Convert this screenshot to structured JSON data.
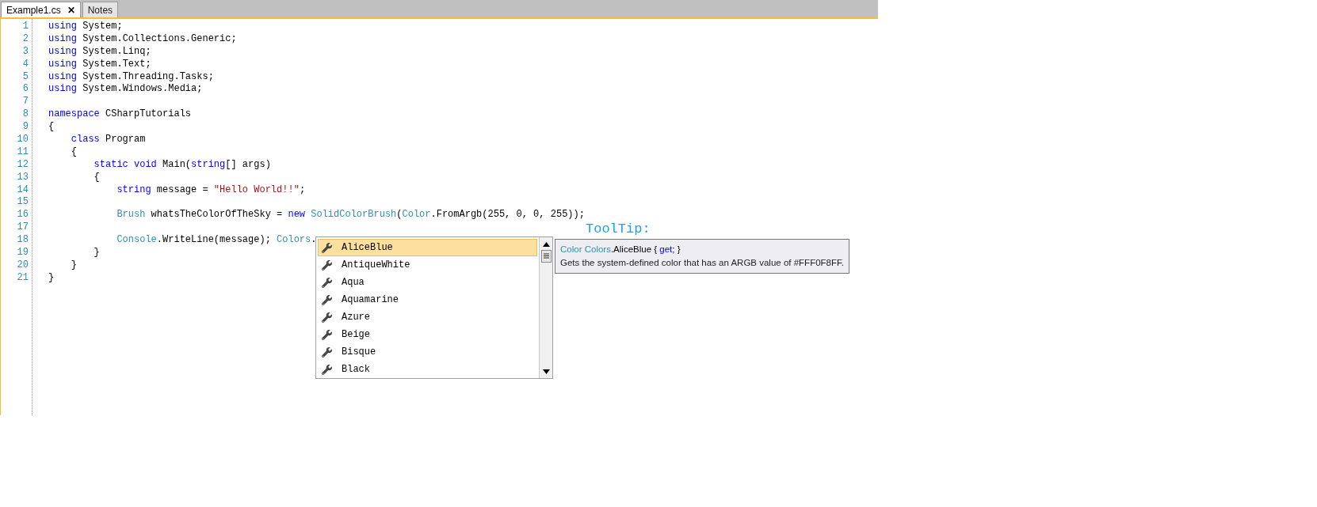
{
  "tabs": [
    {
      "label": "Example1.cs",
      "selected": true,
      "close": "✕"
    },
    {
      "label": "Notes",
      "selected": false
    }
  ],
  "code_lines": [
    {
      "number": "1",
      "tokens": [
        {
          "kind": "keyword",
          "text": "using"
        },
        {
          "kind": "plain",
          "text": " System;"
        }
      ]
    },
    {
      "number": "2",
      "tokens": [
        {
          "kind": "keyword",
          "text": "using"
        },
        {
          "kind": "plain",
          "text": " System.Collections.Generic;"
        }
      ]
    },
    {
      "number": "3",
      "tokens": [
        {
          "kind": "keyword",
          "text": "using"
        },
        {
          "kind": "plain",
          "text": " System.Linq;"
        }
      ]
    },
    {
      "number": "4",
      "tokens": [
        {
          "kind": "keyword",
          "text": "using"
        },
        {
          "kind": "plain",
          "text": " System.Text;"
        }
      ]
    },
    {
      "number": "5",
      "tokens": [
        {
          "kind": "keyword",
          "text": "using"
        },
        {
          "kind": "plain",
          "text": " System.Threading.Tasks;"
        }
      ]
    },
    {
      "number": "6",
      "tokens": [
        {
          "kind": "keyword",
          "text": "using"
        },
        {
          "kind": "plain",
          "text": " System.Windows.Media;"
        }
      ]
    },
    {
      "number": "7"
    },
    {
      "number": "8",
      "tokens": [
        {
          "kind": "keyword",
          "text": "namespace"
        },
        {
          "kind": "plain",
          "text": " CSharpTutorials"
        }
      ]
    },
    {
      "number": "9",
      "tokens": [
        {
          "kind": "plain",
          "text": "{"
        }
      ]
    },
    {
      "number": "10",
      "tokens": [
        {
          "kind": "keyword",
          "text": "    class"
        },
        {
          "kind": "plain",
          "text": " Program"
        }
      ]
    },
    {
      "number": "11",
      "tokens": [
        {
          "kind": "plain",
          "text": "    {"
        }
      ]
    },
    {
      "number": "12",
      "tokens": [
        {
          "kind": "keyword",
          "text": "        static void"
        },
        {
          "kind": "plain",
          "text": " Main("
        },
        {
          "kind": "keyword",
          "text": "string"
        },
        {
          "kind": "plain",
          "text": "[] args)"
        }
      ]
    },
    {
      "number": "13",
      "tokens": [
        {
          "kind": "plain",
          "text": "        {"
        }
      ]
    },
    {
      "number": "14",
      "tokens": [
        {
          "kind": "keyword",
          "text": "            string"
        },
        {
          "kind": "plain",
          "text": " message = "
        },
        {
          "kind": "string",
          "text": "\"Hello World!!\""
        },
        {
          "kind": "plain",
          "text": ";"
        }
      ]
    },
    {
      "number": "15"
    },
    {
      "number": "16",
      "tokens": [
        {
          "kind": "type",
          "text": "            Brush"
        },
        {
          "kind": "plain",
          "text": " whatsTheColorOfTheSky = "
        },
        {
          "kind": "keyword",
          "text": "new"
        },
        {
          "kind": "type",
          "text": " SolidColorBrush"
        },
        {
          "kind": "plain",
          "text": "("
        },
        {
          "kind": "type",
          "text": "Color"
        },
        {
          "kind": "plain",
          "text": ".FromArgb(255, 0, 0, 255));"
        }
      ]
    },
    {
      "number": "17"
    },
    {
      "number": "18",
      "tokens": [
        {
          "kind": "type",
          "text": "            Console"
        },
        {
          "kind": "plain",
          "text": ".WriteLine(message); "
        },
        {
          "kind": "type",
          "text": "Colors"
        },
        {
          "kind": "plain",
          "text": "."
        }
      ]
    },
    {
      "number": "19",
      "tokens": [
        {
          "kind": "plain",
          "text": "        }"
        }
      ]
    },
    {
      "number": "20",
      "tokens": [
        {
          "kind": "plain",
          "text": "    }"
        }
      ]
    },
    {
      "number": "21",
      "tokens": [
        {
          "kind": "plain",
          "text": "}"
        }
      ]
    }
  ],
  "annotation": "ToolTip:",
  "completion_list": {
    "items": [
      {
        "label": "AliceBlue",
        "selected": true
      },
      {
        "label": "AntiqueWhite",
        "selected": false
      },
      {
        "label": "Aqua",
        "selected": false
      },
      {
        "label": "Aquamarine",
        "selected": false
      },
      {
        "label": "Azure",
        "selected": false
      },
      {
        "label": "Beige",
        "selected": false
      },
      {
        "label": "Bisque",
        "selected": false
      },
      {
        "label": "Black",
        "selected": false
      }
    ]
  },
  "tooltip": {
    "signature": [
      {
        "kind": "type",
        "text": "Color"
      },
      {
        "kind": "type",
        "text": " Colors"
      },
      {
        "kind": "plain",
        "text": ".AliceBlue { "
      },
      {
        "kind": "keyword",
        "text": "get"
      },
      {
        "kind": "plain",
        "text": "; }"
      }
    ],
    "description": "Gets the system-defined color that has an ARGB value of #FFF0F8FF."
  }
}
